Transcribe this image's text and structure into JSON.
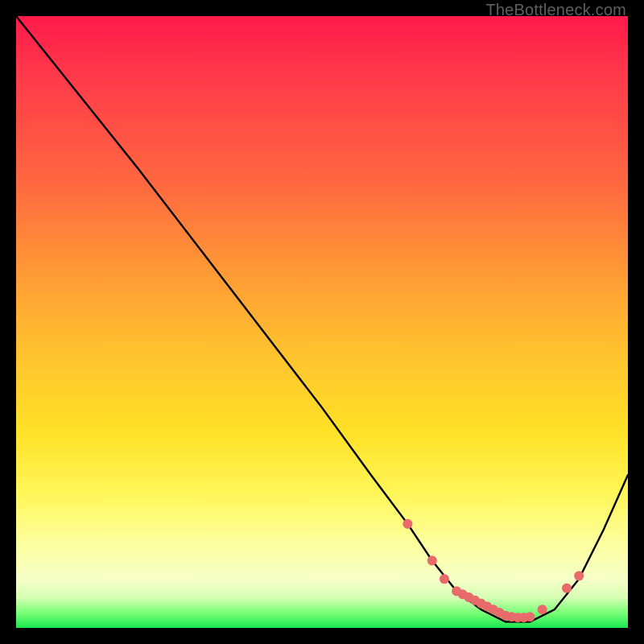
{
  "watermark": "TheBottleneck.com",
  "chart_data": {
    "type": "line",
    "title": "",
    "xlabel": "",
    "ylabel": "",
    "xlim": [
      0,
      100
    ],
    "ylim": [
      0,
      100
    ],
    "grid": false,
    "legend": false,
    "series": [
      {
        "name": "bottleneck-curve",
        "x": [
          0,
          8,
          20,
          30,
          40,
          50,
          58,
          64,
          68,
          72,
          76,
          80,
          84,
          88,
          92,
          96,
          100
        ],
        "y": [
          100,
          90,
          75,
          62,
          49,
          36,
          25,
          17,
          11,
          6,
          3,
          1,
          1,
          3,
          8,
          16,
          25
        ]
      }
    ],
    "markers": {
      "name": "highlight-dots",
      "color": "#e86a6a",
      "x": [
        64,
        68,
        70,
        72,
        73,
        74,
        75,
        76,
        77,
        78,
        79,
        80,
        81,
        82,
        83,
        84,
        86,
        90,
        92
      ],
      "y": [
        17,
        11,
        8,
        6,
        5.5,
        5,
        4.5,
        4,
        3.5,
        3,
        2.5,
        2,
        1.8,
        1.7,
        1.7,
        1.8,
        3,
        6.5,
        8.5
      ]
    }
  }
}
